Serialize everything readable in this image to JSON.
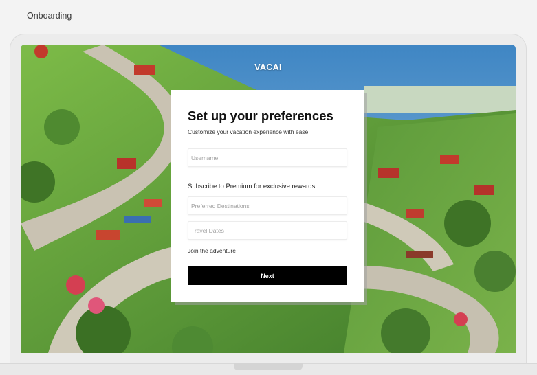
{
  "page": {
    "label": "Onboarding"
  },
  "app": {
    "brand": "VACAI"
  },
  "form": {
    "title": "Set up your preferences",
    "subtitle": "Customize your vacation experience with ease",
    "username_placeholder": "Username",
    "premium_text": "Subscribe to Premium for exclusive rewards",
    "destinations_placeholder": "Preferred Destinations",
    "dates_placeholder": "Travel Dates",
    "join_text": "Join the adventure",
    "next_label": "Next"
  },
  "colors": {
    "button_bg": "#000000",
    "button_text": "#ffffff",
    "card_bg": "#ffffff",
    "sky": "#5f9fcf",
    "grass": "#5c9a3a"
  }
}
